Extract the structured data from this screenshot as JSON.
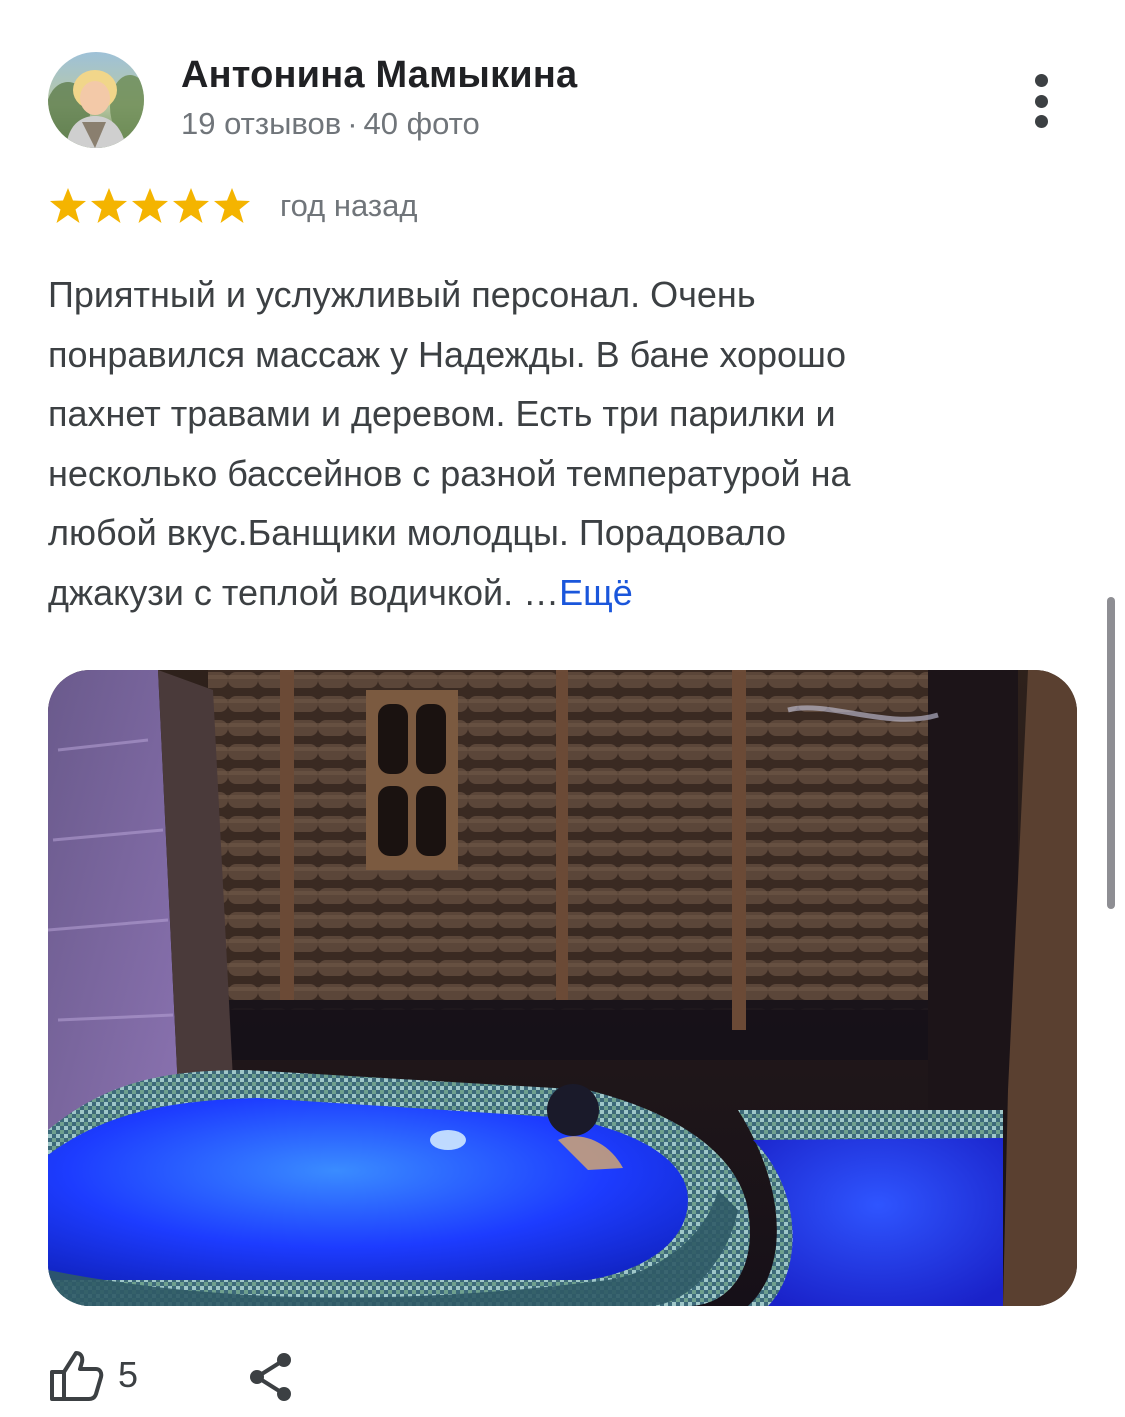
{
  "review": {
    "author": {
      "name": "Антонина Мамыкина",
      "reviews": "19 отзывов",
      "separator": "·",
      "photos": "40 фото",
      "avatar_icon": "user-photo"
    },
    "menu_icon": "more-vert-icon",
    "rating": 5,
    "rating_max": 5,
    "star_color": "#f4b400",
    "date": "год назад",
    "text_lines": [
      "Приятный и услужливый персонал. Очень",
      "понравился массаж у Надежды. В бане хорошо",
      "пахнет травами и деревом. Есть три парилки и",
      "несколько бассейнов с разной температурой на",
      "любой вкус.Банщики молодцы. Порадовало",
      "джакузи с теплой водичкой. …"
    ],
    "more_label": "Ещё",
    "link_color": "#1a56db",
    "photo": {
      "subject": "jacuzzi-in-wooden-bathhouse"
    },
    "actions": {
      "like_icon": "thumbs-up-icon",
      "like_count": "5",
      "share_icon": "share-icon"
    }
  }
}
